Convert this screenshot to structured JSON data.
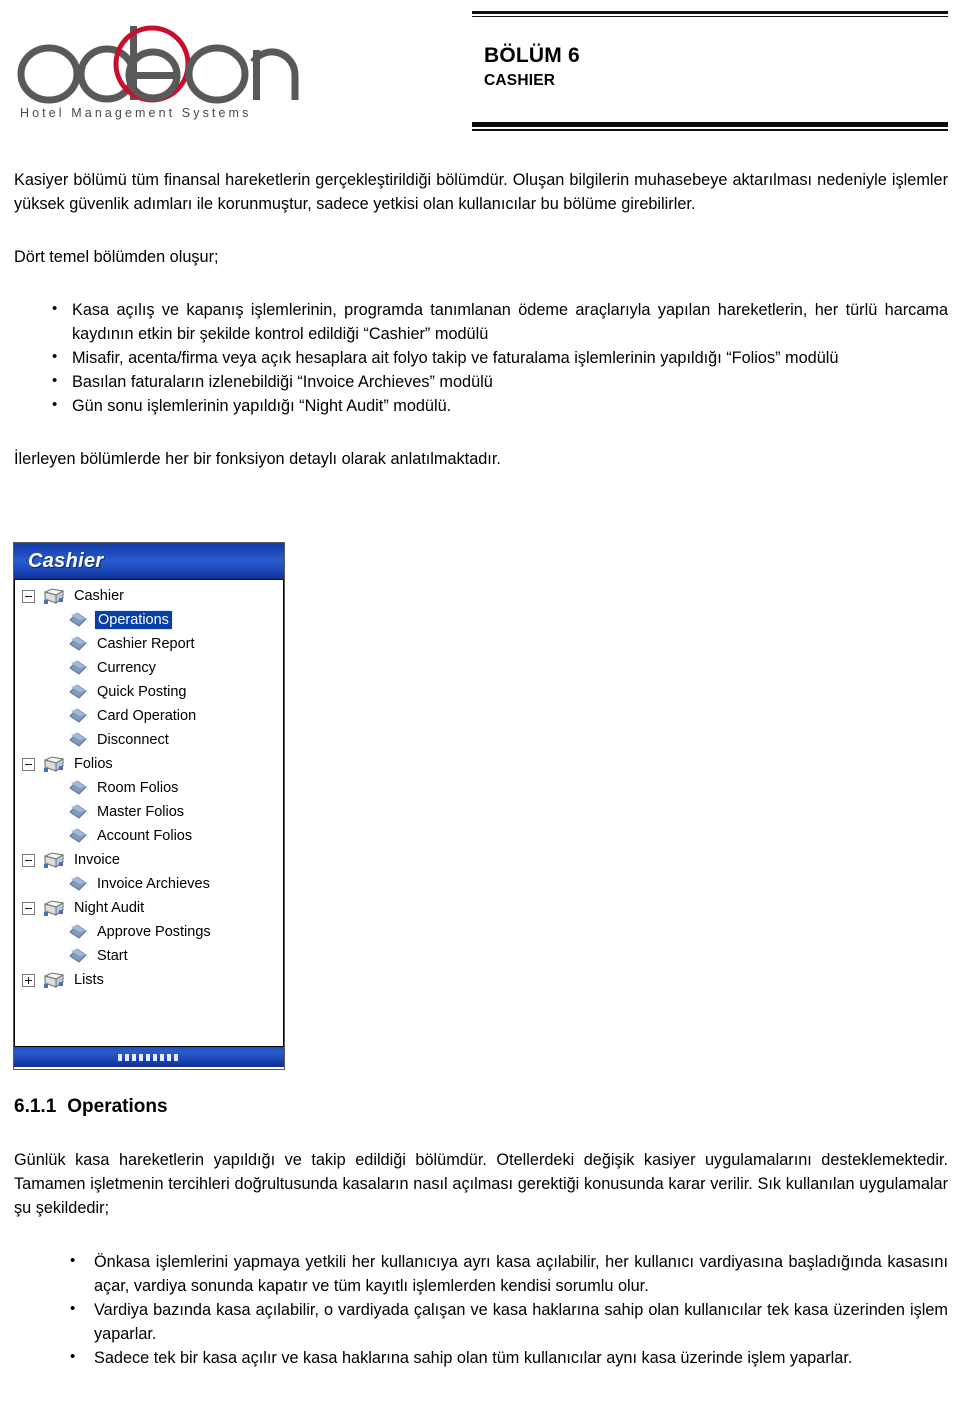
{
  "header": {
    "logo": {
      "wordmark": "odeon",
      "tagline": "Hotel Management Systems",
      "accent_color": "#c8102e",
      "text_color": "#4a4a4a"
    },
    "chapter_number": "BÖLÜM 6",
    "chapter_name": "CASHIER"
  },
  "intro": {
    "paragraph": "Kasiyer bölümü tüm finansal hareketlerin gerçekleştirildiği bölümdür. Oluşan bilgilerin muhasebeye aktarılması nedeniyle işlemler yüksek güvenlik adımları ile korunmuştur, sadece yetkisi olan kullanıcılar bu bölüme girebilirler.",
    "lead_in": "Dört temel bölümden oluşur;",
    "modules": [
      "Kasa açılış ve kapanış işlemlerinin, programda tanımlanan ödeme araçlarıyla yapılan hareketlerin, her türlü harcama kaydının etkin bir şekilde kontrol edildiği “Cashier” modülü",
      "Misafir, acenta/firma veya açık hesaplara ait folyo takip ve faturalama işlemlerinin yapıldığı “Folios” modülü",
      "Basılan faturaların izlenebildiği “Invoice Archieves” modülü",
      "Gün sonu işlemlerinin yapıldığı “Night Audit”   modülü."
    ],
    "closing": "İlerleyen bölümlerde her bir fonksiyon detaylı olarak anlatılmaktadır."
  },
  "tree_widget": {
    "title": "Cashier",
    "title_bar_color": "#1944b5",
    "selection_color": "#0b3fa8",
    "nodes": [
      {
        "label": "Cashier",
        "level": 0,
        "icon": "folder-icon",
        "expander": "minus",
        "selected": false
      },
      {
        "label": "Operations",
        "level": 1,
        "icon": "diamond-icon",
        "expander": "none",
        "selected": true
      },
      {
        "label": "Cashier Report",
        "level": 1,
        "icon": "diamond-icon",
        "expander": "none",
        "selected": false
      },
      {
        "label": "Currency",
        "level": 1,
        "icon": "diamond-icon",
        "expander": "none",
        "selected": false
      },
      {
        "label": "Quick Posting",
        "level": 1,
        "icon": "diamond-icon",
        "expander": "none",
        "selected": false
      },
      {
        "label": "Card Operation",
        "level": 1,
        "icon": "diamond-icon",
        "expander": "none",
        "selected": false
      },
      {
        "label": "Disconnect",
        "level": 1,
        "icon": "diamond-icon",
        "expander": "none",
        "selected": false
      },
      {
        "label": "Folios",
        "level": 0,
        "icon": "folder-icon",
        "expander": "minus",
        "selected": false
      },
      {
        "label": "Room Folios",
        "level": 1,
        "icon": "diamond-icon",
        "expander": "none",
        "selected": false
      },
      {
        "label": "Master Folios",
        "level": 1,
        "icon": "diamond-icon",
        "expander": "none",
        "selected": false
      },
      {
        "label": "Account Folios",
        "level": 1,
        "icon": "diamond-icon",
        "expander": "none",
        "selected": false
      },
      {
        "label": "Invoice",
        "level": 0,
        "icon": "folder-icon",
        "expander": "minus",
        "selected": false
      },
      {
        "label": "Invoice Archieves",
        "level": 1,
        "icon": "diamond-icon",
        "expander": "none",
        "selected": false
      },
      {
        "label": "Night Audit",
        "level": 0,
        "icon": "folder-icon",
        "expander": "minus",
        "selected": false
      },
      {
        "label": "Approve Postings",
        "level": 1,
        "icon": "diamond-icon",
        "expander": "none",
        "selected": false
      },
      {
        "label": "Start",
        "level": 1,
        "icon": "diamond-icon",
        "expander": "none",
        "selected": false
      },
      {
        "label": "Lists",
        "level": 0,
        "icon": "folder-icon",
        "expander": "plus",
        "selected": false
      }
    ]
  },
  "section": {
    "number": "6.1.1",
    "title": "Operations",
    "paragraph": "Günlük kasa hareketlerin yapıldığı ve takip edildiği bölümdür. Otellerdeki değişik kasiyer uygulamalarını desteklemektedir. Tamamen işletmenin tercihleri doğrultusunda kasaların nasıl açılması gerektiği konusunda karar verilir. Sık kullanılan uygulamalar şu şekildedir;",
    "bullets": [
      "Önkasa işlemlerini yapmaya yetkili her kullanıcıya ayrı kasa açılabilir, her kullanıcı vardiyasına başladığında kasasını açar, vardiya sonunda kapatır ve tüm kayıtlı işlemlerden kendisi sorumlu olur.",
      "Vardiya bazında kasa açılabilir, o vardiyada çalışan ve kasa haklarına sahip olan kullanıcılar tek kasa üzerinden işlem yaparlar.",
      "Sadece tek bir kasa açılır ve kasa haklarına sahip olan tüm kullanıcılar aynı kasa üzerinde işlem yaparlar."
    ]
  }
}
